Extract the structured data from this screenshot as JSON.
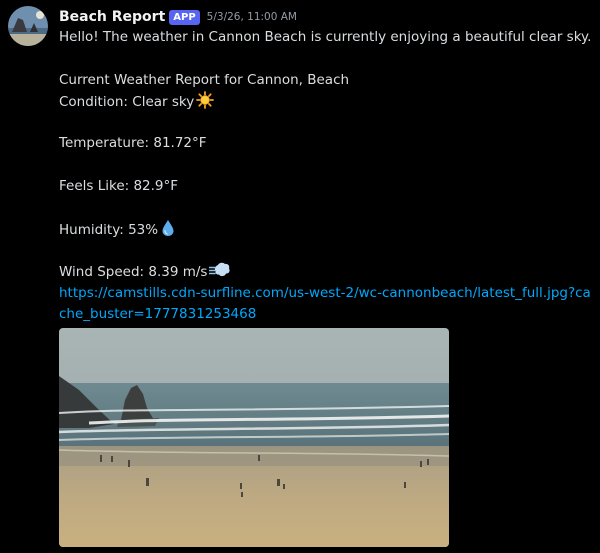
{
  "message": {
    "author": "Beach Report",
    "badge": "APP",
    "timestamp": "5/3/26, 11:00 AM",
    "lines": {
      "greeting": "Hello! The weather in Cannon Beach is currently enjoying a beautiful clear sky.",
      "report_title": "Current Weather Report for Cannon, Beach",
      "condition": "Condition: Clear sky",
      "temperature": "Temperature: 81.72°F",
      "feels_like": "Feels Like: 82.9°F",
      "humidity": "Humidity: 53%",
      "wind_speed": "Wind Speed: 8.39 m/s"
    },
    "link": "https://camstills.cdn-surfline.com/us-west-2/wc-cannonbeach/latest_full.jpg?cache_buster=1777831253468",
    "icons": {
      "avatar": "beach-avatar",
      "condition": "sun-emoji",
      "humidity": "droplet-emoji",
      "wind": "wind-face-emoji"
    },
    "colors": {
      "background": "#000000",
      "username": "#f2f3f5",
      "badge": "#5865f2",
      "timestamp": "#949ba4",
      "text": "#dbdee1",
      "link": "#00a8fc"
    }
  }
}
